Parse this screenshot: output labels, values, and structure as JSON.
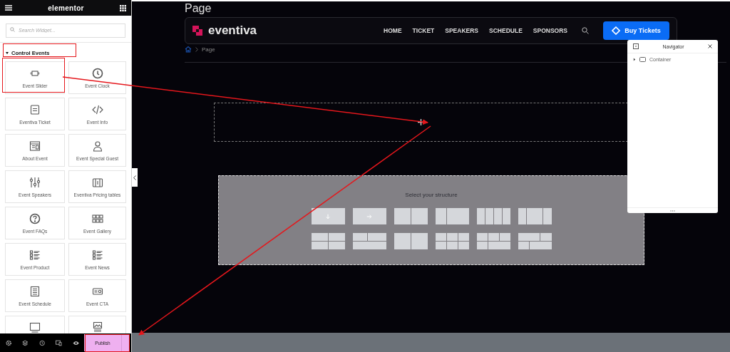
{
  "sidebar": {
    "title": "elementor",
    "search": {
      "placeholder": "Search Widget..."
    },
    "category": {
      "label": "Control Events",
      "expanded": true
    },
    "widgets": [
      {
        "label": "Event Slider"
      },
      {
        "label": "Event Clock"
      },
      {
        "label": "Eventiva Ticket"
      },
      {
        "label": "Event Info"
      },
      {
        "label": "About Event"
      },
      {
        "label": "Event Special Guest"
      },
      {
        "label": "Event Speakers"
      },
      {
        "label": "Eventiva Pricing tables"
      },
      {
        "label": "Event FAQs"
      },
      {
        "label": "Event Gallery"
      },
      {
        "label": "Event Product"
      },
      {
        "label": "Event News"
      },
      {
        "label": "Event Schedule"
      },
      {
        "label": "Event CTA"
      },
      {
        "kind": "label_hidden"
      },
      {
        "kind": "label_hidden"
      }
    ],
    "publish": "Publish"
  },
  "canvas": {
    "page_title": "Page",
    "logo": "eventiva",
    "nav": [
      "HOME",
      "TICKET",
      "SPEAKERS",
      "SCHEDULE",
      "SPONSORS"
    ],
    "cta": "Buy Tickets",
    "breadcrumb": "Page",
    "structure_title": "Select your structure"
  },
  "navigator": {
    "title": "Navigator",
    "items": [
      {
        "label": "Container",
        "expanded": false
      }
    ]
  }
}
